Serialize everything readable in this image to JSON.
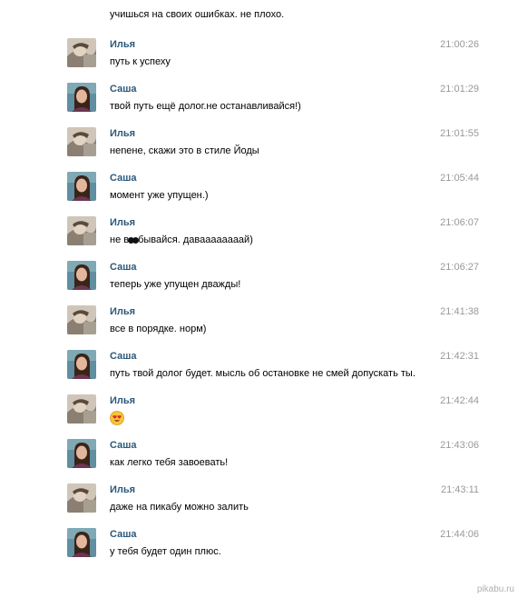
{
  "chat": {
    "top_text": "учишься на своих ошибках. не плохо.",
    "messages": [
      {
        "sender": "Илья",
        "time": "21:00:26",
        "text": "путь к успеху"
      },
      {
        "sender": "Саша",
        "time": "21:01:29",
        "text": "твой путь ещё долог.не останавливайся!)"
      },
      {
        "sender": "Илья",
        "time": "21:01:55",
        "text": "нenене, скажи это в стиле Йоды"
      },
      {
        "sender": "Саша",
        "time": "21:05:44",
        "text": "момент уже упущен.)"
      },
      {
        "sender": "Илья",
        "time": "21:06:07",
        "text_prefix": "не в",
        "text_suffix": "бывайся. даваааааааай)"
      },
      {
        "sender": "Саша",
        "time": "21:06:27",
        "text": "теперь уже упущен дважды!"
      },
      {
        "sender": "Илья",
        "time": "21:41:38",
        "text": "все в порядке. норм)"
      },
      {
        "sender": "Саша",
        "time": "21:42:31",
        "text": "путь твой долог будет. мысль об остановке не смей допускать ты."
      },
      {
        "sender": "Илья",
        "time": "21:42:44",
        "emoji": "heart-eyes-emoji"
      },
      {
        "sender": "Саша",
        "time": "21:43:06",
        "text": "как легко тебя завоевать!"
      },
      {
        "sender": "Илья",
        "time": "21:43:11",
        "text": "даже на пикабу можно залить"
      },
      {
        "sender": "Саша",
        "time": "21:44:06",
        "text": "у тебя будет один плюс."
      }
    ]
  },
  "watermark": "pikabu.ru",
  "colors": {
    "sender_name": "#2b587a",
    "timestamp": "#999999",
    "text": "#000000"
  }
}
